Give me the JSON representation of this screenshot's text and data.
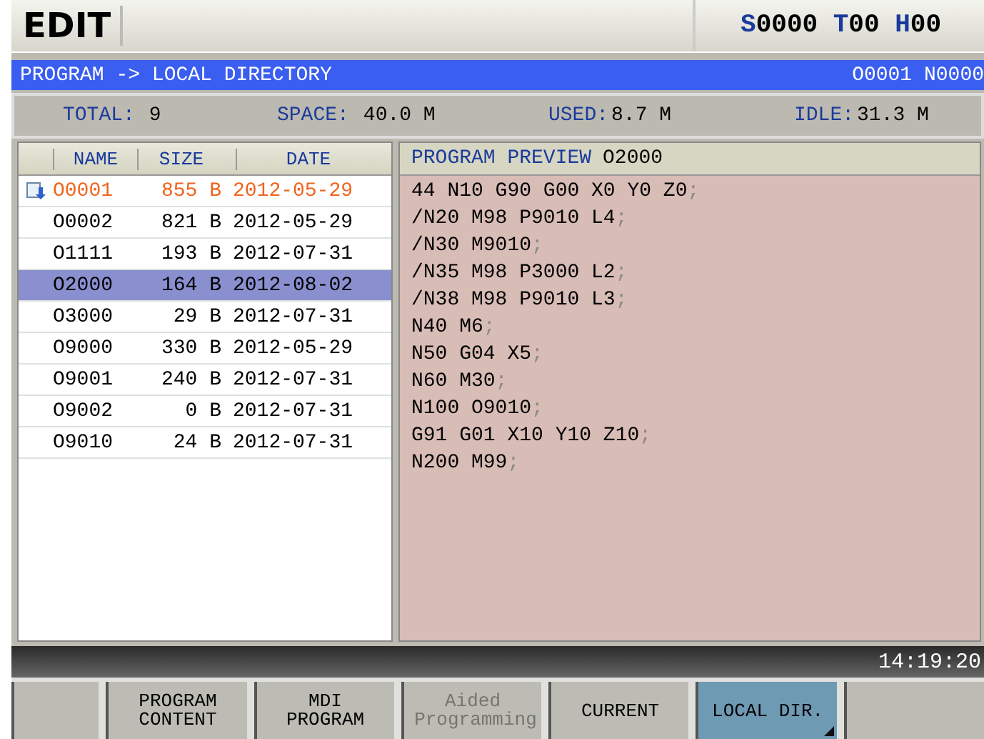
{
  "mode": "EDIT",
  "spindle": {
    "s_label": "S",
    "s_value": "0000",
    "t_label": "T",
    "t_value": "00",
    "h_label": "H",
    "h_value": "00"
  },
  "path_bar": {
    "title": "PROGRAM -> LOCAL DIRECTORY",
    "program": "O0001 N0000"
  },
  "stats": [
    {
      "label": "TOTAL:",
      "value": "9"
    },
    {
      "label": "SPACE:",
      "value": "40.0 M"
    },
    {
      "label": "USED:",
      "value": "8.7 M"
    },
    {
      "label": "IDLE:",
      "value": "31.3 M"
    }
  ],
  "table": {
    "columns": [
      "NAME",
      "SIZE",
      "DATE"
    ],
    "rows": [
      {
        "name": "O0001",
        "size": "855 B",
        "date": "2012-05-29",
        "current": true,
        "selected": false
      },
      {
        "name": "O0002",
        "size": "821 B",
        "date": "2012-05-29",
        "current": false,
        "selected": false
      },
      {
        "name": "O1111",
        "size": "193 B",
        "date": "2012-07-31",
        "current": false,
        "selected": false
      },
      {
        "name": "O2000",
        "size": "164 B",
        "date": "2012-08-02",
        "current": false,
        "selected": true
      },
      {
        "name": "O3000",
        "size": "29 B",
        "date": "2012-07-31",
        "current": false,
        "selected": false
      },
      {
        "name": "O9000",
        "size": "330 B",
        "date": "2012-05-29",
        "current": false,
        "selected": false
      },
      {
        "name": "O9001",
        "size": "240 B",
        "date": "2012-07-31",
        "current": false,
        "selected": false
      },
      {
        "name": "O9002",
        "size": "0 B",
        "date": "2012-07-31",
        "current": false,
        "selected": false
      },
      {
        "name": "O9010",
        "size": "24 B",
        "date": "2012-07-31",
        "current": false,
        "selected": false
      }
    ]
  },
  "preview": {
    "title": "PROGRAM PREVIEW",
    "program": "O2000",
    "lines": [
      {
        "code": "44 N10 G90 G00 X0 Y0 Z0",
        "end": ";"
      },
      {
        "code": "/N20 M98 P9010 L4",
        "end": ";"
      },
      {
        "code": "/N30 M9010",
        "end": ";"
      },
      {
        "code": "/N35 M98 P3000 L2",
        "end": ";"
      },
      {
        "code": "/N38 M98 P9010 L3",
        "end": ";"
      },
      {
        "code": "N40 M6",
        "end": ";"
      },
      {
        "code": "N50 G04 X5",
        "end": ";"
      },
      {
        "code": "N60 M30",
        "end": ";"
      },
      {
        "code": "N100 O9010",
        "end": ";"
      },
      {
        "code": "G91 G01 X10 Y10 Z10",
        "end": ";"
      },
      {
        "code": "N200 M99",
        "end": ";"
      }
    ]
  },
  "clock": "14:19:20",
  "softkeys": [
    {
      "kind": "blank"
    },
    {
      "kind": "key",
      "label": "PROGRAM CONTENT",
      "disabled": false,
      "selected": false
    },
    {
      "kind": "key",
      "label": "MDI PROGRAM",
      "disabled": false,
      "selected": false
    },
    {
      "kind": "key",
      "label": "Aided Programming",
      "disabled": true,
      "selected": false
    },
    {
      "kind": "key",
      "label": "CURRENT",
      "disabled": false,
      "selected": false
    },
    {
      "kind": "key",
      "label": "LOCAL DIR.",
      "disabled": false,
      "selected": true
    },
    {
      "kind": "blank"
    }
  ]
}
